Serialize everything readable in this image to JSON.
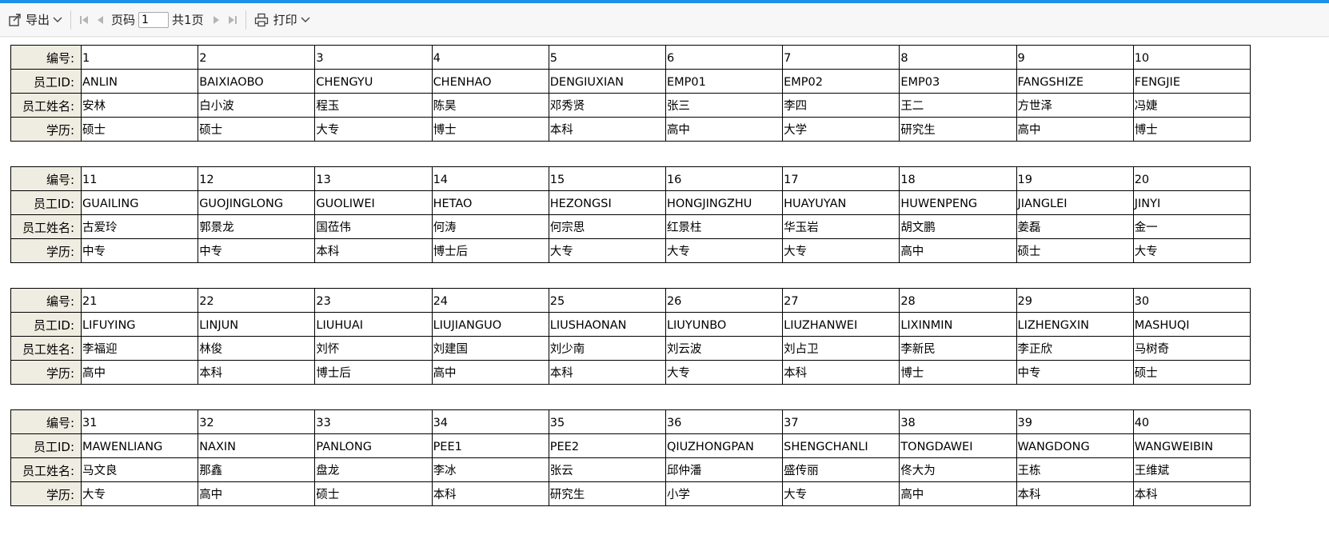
{
  "toolbar": {
    "export_label": "导出",
    "page_label": "页码",
    "page_value": "1",
    "total_label": "共1页",
    "print_label": "打印"
  },
  "labels": {
    "id": "编号:",
    "emp_id": "员工ID:",
    "name": "员工姓名:",
    "edu": "学历:"
  },
  "blocks": [
    {
      "ids": [
        "1",
        "2",
        "3",
        "4",
        "5",
        "6",
        "7",
        "8",
        "9",
        "10"
      ],
      "emp_ids": [
        "ANLIN",
        "BAIXIAOBO",
        "CHENGYU",
        "CHENHAO",
        "DENGIUXIAN",
        "EMP01",
        "EMP02",
        "EMP03",
        "FANGSHIZE",
        "FENGJIE"
      ],
      "names": [
        "安林",
        "白小波",
        "程玉",
        "陈昊",
        "邓秀贤",
        "张三",
        "李四",
        "王二",
        "方世泽",
        "冯婕"
      ],
      "edus": [
        "硕士",
        "硕士",
        "大专",
        "博士",
        "本科",
        "高中",
        "大学",
        "研究生",
        "高中",
        "博士"
      ]
    },
    {
      "ids": [
        "11",
        "12",
        "13",
        "14",
        "15",
        "16",
        "17",
        "18",
        "19",
        "20"
      ],
      "emp_ids": [
        "GUAILING",
        "GUOJINGLONG",
        "GUOLIWEI",
        "HETAO",
        "HEZONGSI",
        "HONGJINGZHU",
        "HUAYUYAN",
        "HUWENPENG",
        "JIANGLEI",
        "JINYI"
      ],
      "names": [
        "古爱玲",
        "郭景龙",
        "国莅伟",
        "何涛",
        "何宗思",
        "红景柱",
        "华玉岩",
        "胡文鹏",
        "姜磊",
        "金一"
      ],
      "edus": [
        "中专",
        "中专",
        "本科",
        "博士后",
        "大专",
        "大专",
        "大专",
        "高中",
        "硕士",
        "大专"
      ]
    },
    {
      "ids": [
        "21",
        "22",
        "23",
        "24",
        "25",
        "26",
        "27",
        "28",
        "29",
        "30"
      ],
      "emp_ids": [
        "LIFUYING",
        "LINJUN",
        "LIUHUAI",
        "LIUJIANGUO",
        "LIUSHAONAN",
        "LIUYUNBO",
        "LIUZHANWEI",
        "LIXINMIN",
        "LIZHENGXIN",
        "MASHUQI"
      ],
      "names": [
        "李福迎",
        "林俊",
        "刘怀",
        "刘建国",
        "刘少南",
        "刘云波",
        "刘占卫",
        "李新民",
        "李正欣",
        "马树奇"
      ],
      "edus": [
        "高中",
        "本科",
        "博士后",
        "高中",
        "本科",
        "大专",
        "本科",
        "博士",
        "中专",
        "硕士"
      ]
    },
    {
      "ids": [
        "31",
        "32",
        "33",
        "34",
        "35",
        "36",
        "37",
        "38",
        "39",
        "40"
      ],
      "emp_ids": [
        "MAWENLIANG",
        "NAXIN",
        "PANLONG",
        "PEE1",
        "PEE2",
        "QIUZHONGPAN",
        "SHENGCHANLI",
        "TONGDAWEI",
        "WANGDONG",
        "WANGWEIBIN"
      ],
      "names": [
        "马文良",
        "那鑫",
        "盘龙",
        "李冰",
        "张云",
        "邱仲潘",
        "盛传丽",
        "佟大为",
        "王栋",
        "王维斌"
      ],
      "edus": [
        "大专",
        "高中",
        "硕士",
        "本科",
        "研究生",
        "小学",
        "大专",
        "高中",
        "本科",
        "本科"
      ]
    }
  ]
}
